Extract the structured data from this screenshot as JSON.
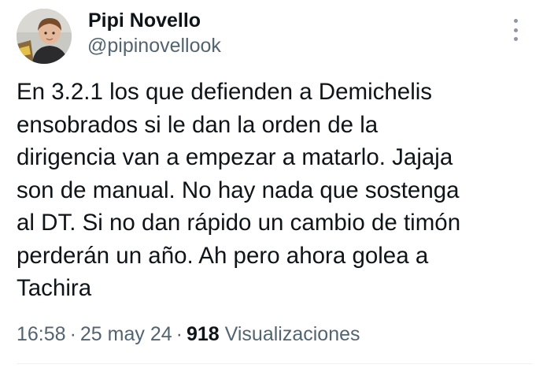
{
  "author": {
    "display_name": "Pipi Novello",
    "handle": "@pipinovellook",
    "avatar_icon": "child-portrait-avatar"
  },
  "menu": {
    "icon": "more-vertical-icon"
  },
  "tweet": {
    "lines": [
      "En 3.2.1 los que defienden a Demichelis",
      "ensobrados si le dan la orden de la",
      "dirigencia van a empezar a matarlo. Jajaja",
      "son de manual. No hay nada que sostenga",
      "al DT. Si no dan rápido un cambio de timón",
      "perderán un año. Ah pero ahora golea a",
      "Tachira"
    ]
  },
  "meta": {
    "time": "16:58",
    "separator": "·",
    "date": "25 may 24",
    "views_count": "918",
    "views_label": "Visualizaciones"
  },
  "colors": {
    "primary_text": "#0f1419",
    "secondary_text": "#536471",
    "background": "#ffffff"
  }
}
